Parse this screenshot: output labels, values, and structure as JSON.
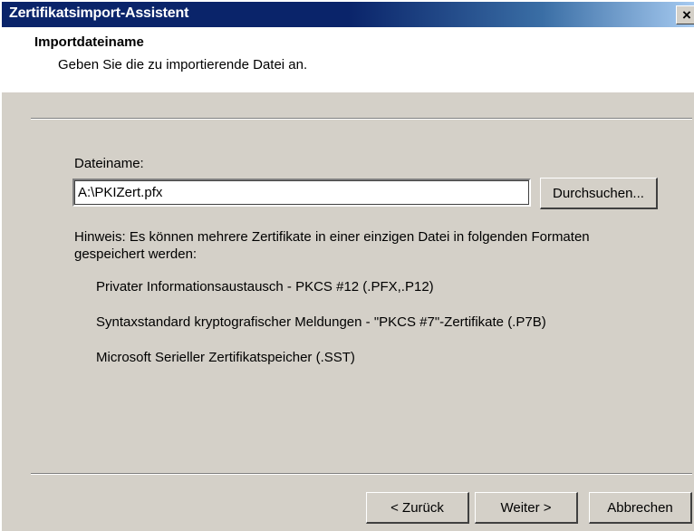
{
  "window": {
    "title": "Zertifikatsimport-Assistent",
    "close_label": "×"
  },
  "header": {
    "title": "Importdateiname",
    "subtitle": "Geben Sie die zu importierende Datei an."
  },
  "form": {
    "filename_label": "Dateiname:",
    "filename_value": "A:\\PKIZert.pfx",
    "browse_label": "Durchsuchen..."
  },
  "hint": {
    "line1": "Hinweis: Es können mehrere Zertifikate in einer einzigen Datei in folgenden Formaten",
    "line2": "gespeichert werden:",
    "formats": [
      "Privater Informationsaustausch - PKCS #12 (.PFX,.P12)",
      "Syntaxstandard kryptografischer Meldungen - \"PKCS #7\"-Zertifikate (.P7B)",
      "Microsoft Serieller Zertifikatspeicher (.SST)"
    ]
  },
  "buttons": {
    "back": "< Zurück",
    "next": "Weiter >",
    "cancel": "Abbrechen"
  },
  "colors": {
    "titlebar_start": "#0a246a",
    "titlebar_end": "#a6caf0",
    "dialog_bg": "#d4d0c8"
  }
}
